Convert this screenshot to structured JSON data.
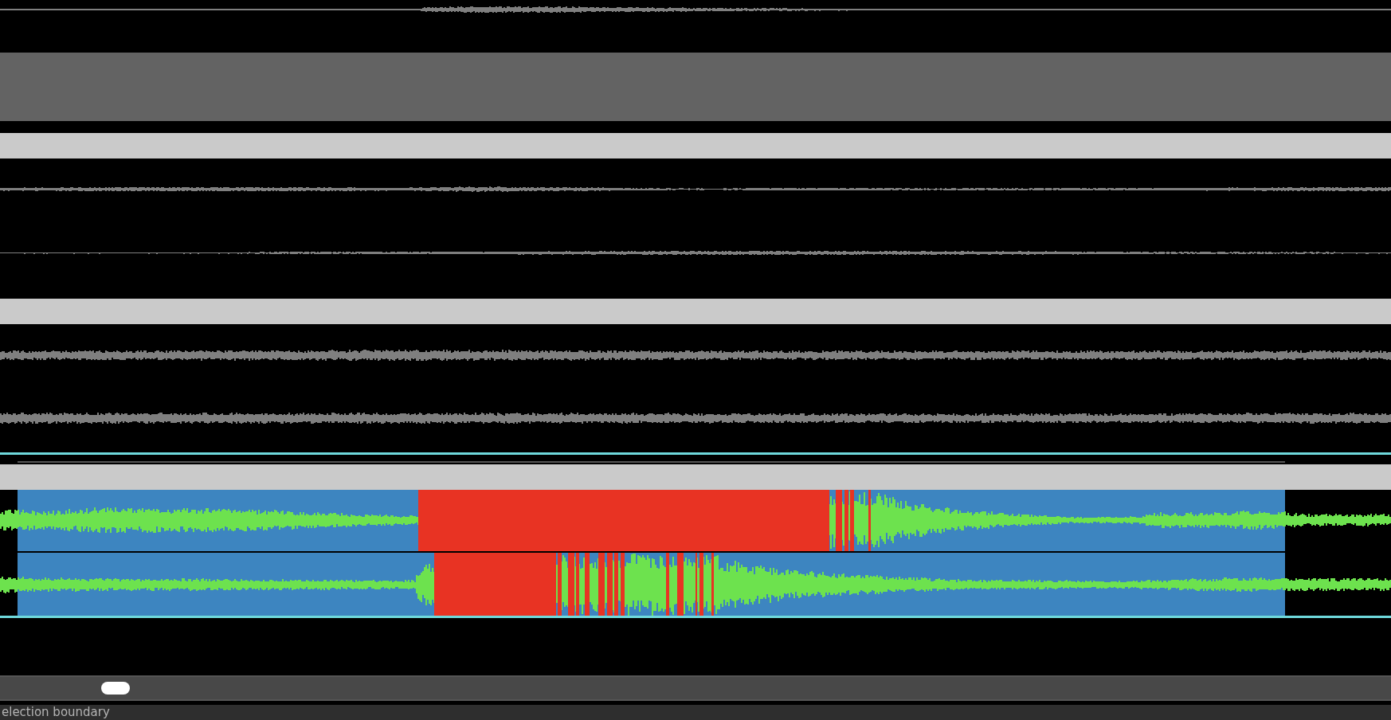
{
  "tracks": [
    {
      "kind": "partial",
      "selected": false
    },
    {
      "kind": "blank",
      "selected": false
    },
    {
      "kind": "stereo",
      "selected": false
    },
    {
      "kind": "stereo",
      "selected": false
    },
    {
      "kind": "stereo",
      "selected": true
    }
  ],
  "status_bar": {
    "text": "election boundary"
  }
}
